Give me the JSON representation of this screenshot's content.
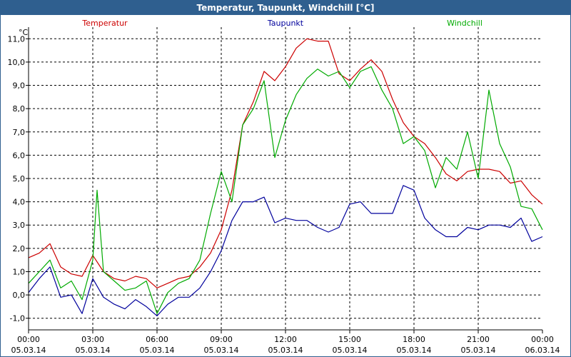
{
  "window": {
    "title": "Temperatur, Taupunkt, Windchill [°C]"
  },
  "chart_data": {
    "type": "line",
    "title": "Temperatur, Taupunkt, Windchill [°C]",
    "ylabel": "°C",
    "xlabel": "",
    "ylim": [
      -1.5,
      11.5
    ],
    "xlim": [
      0,
      24
    ],
    "grid": true,
    "legend_placement": "top",
    "yticks": [
      "-1,0",
      "0,0",
      "1,0",
      "2,0",
      "3,0",
      "4,0",
      "5,0",
      "6,0",
      "7,0",
      "8,0",
      "9,0",
      "10,0",
      "11,0"
    ],
    "ytick_values": [
      -1,
      0,
      1,
      2,
      3,
      4,
      5,
      6,
      7,
      8,
      9,
      10,
      11
    ],
    "xticks": [
      {
        "time": "00:00",
        "date": "05.03.14",
        "x": 0
      },
      {
        "time": "03:00",
        "date": "05.03.14",
        "x": 3
      },
      {
        "time": "06:00",
        "date": "05.03.14",
        "x": 6
      },
      {
        "time": "09:00",
        "date": "05.03.14",
        "x": 9
      },
      {
        "time": "12:00",
        "date": "05.03.14",
        "x": 12
      },
      {
        "time": "15:00",
        "date": "05.03.14",
        "x": 15
      },
      {
        "time": "18:00",
        "date": "05.03.14",
        "x": 18
      },
      {
        "time": "21:00",
        "date": "05.03.14",
        "x": 21
      },
      {
        "time": "00:00",
        "date": "06.03.14",
        "x": 24
      }
    ],
    "series": [
      {
        "name": "Temperatur",
        "color": "#cc0000",
        "x": [
          0,
          0.5,
          1,
          1.5,
          2,
          2.5,
          3,
          3.5,
          4,
          4.5,
          5,
          5.5,
          6,
          6.5,
          7,
          7.5,
          8,
          8.5,
          9,
          9.5,
          10,
          10.5,
          11,
          11.5,
          12,
          12.5,
          13,
          13.5,
          14,
          14.5,
          15,
          15.5,
          16,
          16.5,
          17,
          17.5,
          18,
          18.5,
          19,
          19.5,
          20,
          20.5,
          21,
          21.5,
          22,
          22.5,
          23,
          23.5,
          24
        ],
        "values": [
          1.6,
          1.8,
          2.2,
          1.2,
          0.9,
          0.8,
          1.7,
          1.0,
          0.7,
          0.6,
          0.8,
          0.7,
          0.3,
          0.5,
          0.7,
          0.8,
          1.2,
          1.8,
          2.8,
          4.5,
          7.3,
          8.3,
          9.6,
          9.2,
          9.8,
          10.6,
          11.0,
          10.9,
          10.9,
          9.5,
          9.2,
          9.7,
          10.1,
          9.6,
          8.4,
          7.4,
          6.8,
          6.5,
          5.9,
          5.2,
          4.9,
          5.3,
          5.4,
          5.4,
          5.3,
          4.8,
          4.9,
          4.3,
          3.9
        ]
      },
      {
        "name": "Taupunkt",
        "color": "#00009c",
        "x": [
          0,
          0.5,
          1,
          1.5,
          2,
          2.5,
          3,
          3.5,
          4,
          4.5,
          5,
          5.5,
          6,
          6.5,
          7,
          7.5,
          8,
          8.5,
          9,
          9.5,
          10,
          10.5,
          11,
          11.5,
          12,
          12.5,
          13,
          13.5,
          14,
          14.5,
          15,
          15.5,
          16,
          16.5,
          17,
          17.5,
          18,
          18.5,
          19,
          19.5,
          20,
          20.5,
          21,
          21.5,
          22,
          22.5,
          23,
          23.5,
          24
        ],
        "values": [
          0.1,
          0.7,
          1.2,
          -0.1,
          0.0,
          -0.8,
          0.7,
          -0.1,
          -0.4,
          -0.6,
          -0.2,
          -0.5,
          -0.9,
          -0.4,
          -0.1,
          -0.1,
          0.3,
          1.0,
          1.9,
          3.2,
          4.0,
          4.0,
          4.2,
          3.1,
          3.3,
          3.2,
          3.2,
          2.9,
          2.7,
          2.9,
          3.9,
          4.0,
          3.5,
          3.5,
          3.5,
          4.7,
          4.5,
          3.3,
          2.8,
          2.5,
          2.5,
          2.9,
          2.8,
          3.0,
          3.0,
          2.9,
          3.3,
          2.3,
          2.5
        ]
      },
      {
        "name": "Windchill",
        "color": "#00aa00",
        "x": [
          0,
          0.5,
          1,
          1.5,
          2,
          2.5,
          3,
          3.2,
          3.5,
          4,
          4.5,
          5,
          5.5,
          6,
          6.5,
          7,
          7.5,
          8,
          8.5,
          9,
          9.5,
          10,
          10.5,
          11,
          11.5,
          12,
          12.5,
          13,
          13.5,
          14,
          14.5,
          15,
          15.5,
          16,
          16.5,
          17,
          17.5,
          18,
          18.5,
          19,
          19.5,
          20,
          20.5,
          21,
          21.5,
          22,
          22.5,
          23,
          23.5,
          24
        ],
        "values": [
          0.5,
          1.0,
          1.5,
          0.3,
          0.6,
          -0.2,
          1.5,
          4.5,
          1.0,
          0.6,
          0.2,
          0.3,
          0.6,
          -0.8,
          0.1,
          0.5,
          0.7,
          1.5,
          3.5,
          5.3,
          4.0,
          7.3,
          8.0,
          9.2,
          5.9,
          7.5,
          8.6,
          9.3,
          9.7,
          9.4,
          9.6,
          8.9,
          9.6,
          9.8,
          8.8,
          8.0,
          6.5,
          6.8,
          6.2,
          4.6,
          5.9,
          5.4,
          7.0,
          5.0,
          8.8,
          6.5,
          5.5,
          3.8,
          3.7,
          2.8
        ]
      }
    ]
  }
}
